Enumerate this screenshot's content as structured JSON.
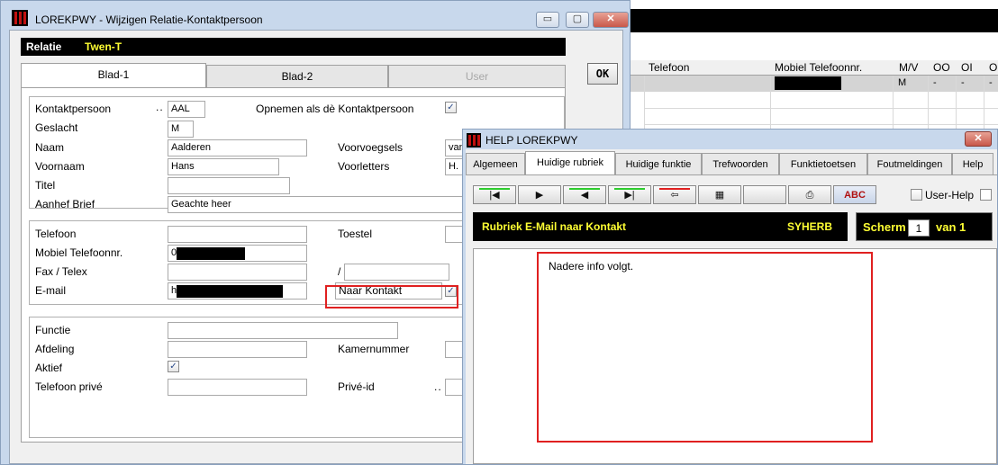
{
  "background_window": {
    "columns": [
      "Telefoon",
      "Mobiel Telefoonnr.",
      "M/V",
      "OO",
      "OI",
      "O"
    ],
    "row1": {
      "mv": "M",
      "oo": "-",
      "oi": "-",
      "o": "-"
    }
  },
  "main_window": {
    "title": "LOREKPWY - Wijzigen Relatie-Kontaktpersoon",
    "controls": {
      "minimize": "▭",
      "maximize": "▢",
      "close": "✕"
    },
    "relatie_label": "Relatie",
    "relatie_value": "Twen-T",
    "tabs": [
      {
        "label": "Blad-1",
        "state": "active"
      },
      {
        "label": "Blad-2",
        "state": "normal"
      },
      {
        "label": "User",
        "state": "disabled"
      }
    ],
    "ok_label": "OK",
    "contact": {
      "kontaktpersoon_label": "Kontaktpersoon",
      "kontaktpersoon_value": "AAL",
      "opnemen_label": "Opnemen als dè Kontaktpersoon",
      "opnemen_checked": true,
      "geslacht_label": "Geslacht",
      "geslacht_value": "M",
      "naam_label": "Naam",
      "naam_value": "Aalderen",
      "voorvoegsels_label": "Voorvoegsels",
      "voorvoegsels_value": "van",
      "voornaam_label": "Voornaam",
      "voornaam_value": "Hans",
      "voorletters_label": "Voorletters",
      "voorletters_value": "H.",
      "titel_label": "Titel",
      "titel_value": "",
      "aanhef_label": "Aanhef Brief",
      "aanhef_value": "Geachte heer"
    },
    "communication": {
      "telefoon_label": "Telefoon",
      "toestel_label": "Toestel",
      "mobiel_label": "Mobiel Telefoonnr.",
      "mobiel_prefix": "0",
      "fax_label": "Fax / Telex",
      "slash": "/",
      "email_label": "E-mail",
      "email_prefix": "h",
      "naar_kontakt_label": "Naar Kontakt",
      "naar_kontakt_checked": true
    },
    "function": {
      "functie_label": "Functie",
      "afdeling_label": "Afdeling",
      "kamernummer_label": "Kamernummer",
      "aktief_label": "Aktief",
      "aktief_checked": true,
      "telefoon_prive_label": "Telefoon privé",
      "prive_id_label": "Privé-id"
    }
  },
  "help_window": {
    "title": "HELP LOREKPWY",
    "close": "✕",
    "tabs": [
      "Algemeen",
      "Huidige rubriek",
      "Huidige funktie",
      "Trefwoorden",
      "Funktietoetsen",
      "Foutmeldingen",
      "Help"
    ],
    "active_tab": "Huidige rubriek",
    "toolbar": [
      {
        "name": "first-icon",
        "glyph": "|◀"
      },
      {
        "name": "next-icon",
        "glyph": "▶"
      },
      {
        "name": "previous-icon",
        "glyph": "◀"
      },
      {
        "name": "last-icon",
        "glyph": "▶|"
      },
      {
        "name": "back-arrow-icon",
        "glyph": "⇦"
      },
      {
        "name": "calculator-icon",
        "glyph": "▦"
      },
      {
        "name": "blank-icon",
        "glyph": ""
      },
      {
        "name": "printer-icon",
        "glyph": "⎙"
      },
      {
        "name": "spellcheck-icon",
        "glyph": "ABC"
      }
    ],
    "user_help_label": "User-Help",
    "rubriek_title": "Rubriek E-Mail naar Kontakt",
    "rubriek_code": "SYHERB",
    "scherm_label": "Scherm",
    "scherm_value": "1",
    "scherm_van": "van 1",
    "content_text": "Nadere info volgt.",
    "colors": {
      "accent_text": "#ffff33",
      "highlight": "#e02020",
      "nav_green": "#2ecc2e"
    }
  }
}
